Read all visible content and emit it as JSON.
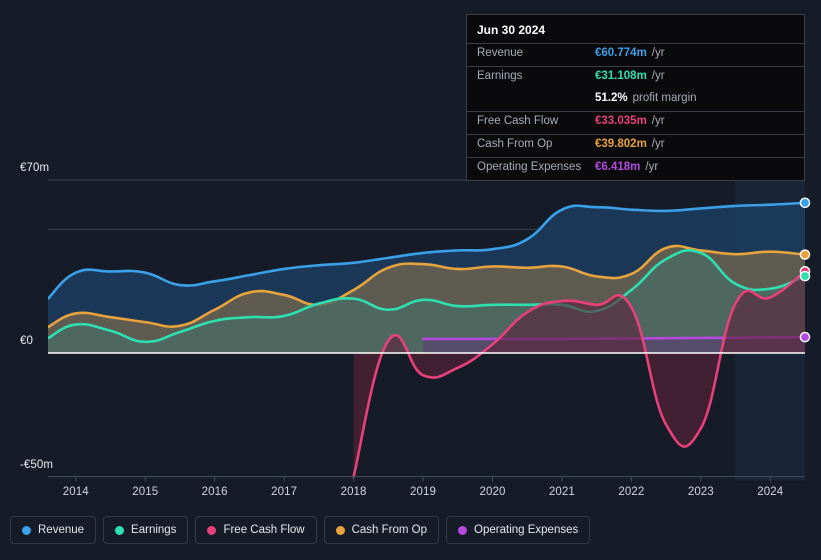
{
  "background_color": "#151c28",
  "tooltip": {
    "title": "Jun 30 2024",
    "rows": [
      {
        "label": "Revenue",
        "value": "€60.774m",
        "unit": "/yr",
        "color": "#3aa0e8"
      },
      {
        "label": "Earnings",
        "value": "€31.108m",
        "unit": "/yr",
        "color": "#2ee0b0"
      },
      {
        "label": "",
        "value": "51.2%",
        "unit": "profit margin",
        "color": "#ffffff"
      },
      {
        "label": "Free Cash Flow",
        "value": "€33.035m",
        "unit": "/yr",
        "color": "#e8407a"
      },
      {
        "label": "Cash From Op",
        "value": "€39.802m",
        "unit": "/yr",
        "color": "#e8a33d"
      },
      {
        "label": "Operating Expenses",
        "value": "€6.418m",
        "unit": "/yr",
        "color": "#b44ae0"
      }
    ]
  },
  "legend": {
    "items": [
      {
        "label": "Revenue",
        "color": "#3aa0e8"
      },
      {
        "label": "Earnings",
        "color": "#2ee0b0"
      },
      {
        "label": "Free Cash Flow",
        "color": "#e8407a"
      },
      {
        "label": "Cash From Op",
        "color": "#e8a33d"
      },
      {
        "label": "Operating Expenses",
        "color": "#b44ae0"
      }
    ]
  },
  "chart_data": {
    "type": "area",
    "title": "",
    "xlabel": "",
    "ylabel": "",
    "currency": "EUR",
    "units": "millions",
    "grid": true,
    "legend_position": "bottom",
    "ylim": [
      -50,
      70
    ],
    "y_ticks": [
      {
        "value": 70,
        "label": "€70m"
      },
      {
        "value": 0,
        "label": "€0"
      },
      {
        "value": -50,
        "label": "-€50m"
      }
    ],
    "x_tick_labels": [
      "2014",
      "2015",
      "2016",
      "2017",
      "2018",
      "2019",
      "2020",
      "2021",
      "2022",
      "2023",
      "2024"
    ],
    "x": [
      2013.6,
      2014.0,
      2014.5,
      2015.0,
      2015.5,
      2016.0,
      2016.5,
      2017.0,
      2017.5,
      2018.0,
      2018.5,
      2019.0,
      2019.5,
      2020.0,
      2020.5,
      2021.0,
      2021.5,
      2022.0,
      2022.5,
      2023.0,
      2023.5,
      2024.0,
      2024.5
    ],
    "series": [
      {
        "name": "Revenue",
        "color": "#3aa0e8",
        "fill": "#1b3a5c",
        "values": [
          22.0,
          32.5,
          33.0,
          32.5,
          27.5,
          29.0,
          31.5,
          34.0,
          35.5,
          36.5,
          38.5,
          40.5,
          41.5,
          42.0,
          46.0,
          58.0,
          59.0,
          58.0,
          57.5,
          58.5,
          59.5,
          60.0,
          60.774
        ]
      },
      {
        "name": "Earnings",
        "color": "#2ee0b0",
        "fill": "#4a6a63",
        "values": [
          6.0,
          11.5,
          9.0,
          4.5,
          8.5,
          13.0,
          14.5,
          15.0,
          20.0,
          22.0,
          17.5,
          21.5,
          19.0,
          19.5,
          19.5,
          19.5,
          17.0,
          25.5,
          38.0,
          40.5,
          28.0,
          26.0,
          31.108
        ]
      },
      {
        "name": "Cash From Op",
        "color": "#e8a33d",
        "fill": "#6a6350",
        "values": [
          10.5,
          16.0,
          14.5,
          12.5,
          11.0,
          17.5,
          24.5,
          23.5,
          19.5,
          25.5,
          34.5,
          36.0,
          34.0,
          35.0,
          34.5,
          35.0,
          31.0,
          32.0,
          42.5,
          41.5,
          40.0,
          41.0,
          39.802
        ]
      },
      {
        "name": "Free Cash Flow",
        "color": "#e8407a",
        "fill": "#5c2438",
        "values": [
          null,
          null,
          null,
          null,
          null,
          null,
          null,
          null,
          null,
          -50.0,
          5.0,
          -9.0,
          -6.0,
          3.5,
          16.5,
          21.0,
          19.5,
          18.5,
          -29.0,
          -30.5,
          20.0,
          22.5,
          33.035
        ]
      },
      {
        "name": "Operating Expenses",
        "color": "#b44ae0",
        "fill": "#5a3a72",
        "values": [
          null,
          null,
          null,
          null,
          null,
          null,
          null,
          null,
          null,
          null,
          null,
          5.7,
          5.7,
          5.7,
          5.7,
          5.7,
          5.8,
          5.9,
          6.0,
          6.1,
          6.2,
          6.3,
          6.418
        ]
      }
    ],
    "end_markers": [
      {
        "name": "Revenue",
        "value": 60.774,
        "color": "#3aa0e8"
      },
      {
        "name": "Cash From Op",
        "value": 39.802,
        "color": "#e8a33d"
      },
      {
        "name": "Free Cash Flow",
        "value": 33.035,
        "color": "#e8407a"
      },
      {
        "name": "Earnings",
        "value": 31.108,
        "color": "#2ee0b0"
      },
      {
        "name": "Operating Expenses",
        "value": 6.418,
        "color": "#b44ae0"
      }
    ]
  }
}
